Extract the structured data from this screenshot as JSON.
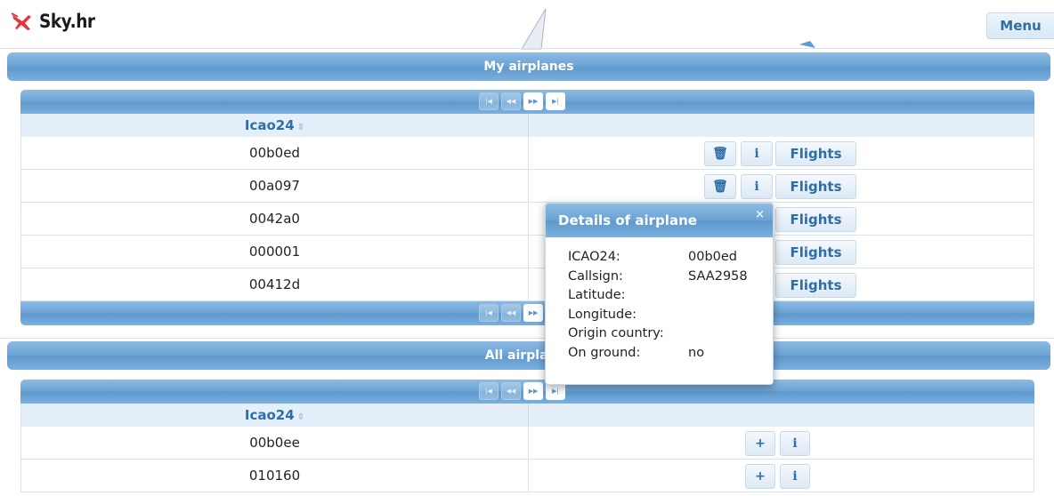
{
  "header": {
    "logo_text": "Sky.hr",
    "menu_label": "Menu"
  },
  "my_airplanes": {
    "title": "My airplanes",
    "column_header": "Icao24",
    "sort_glyph": "⇳",
    "rows": [
      {
        "icao24": "00b0ed",
        "flights_label": "Flights"
      },
      {
        "icao24": "00a097",
        "flights_label": "Flights"
      },
      {
        "icao24": "0042a0",
        "flights_label": "Flights"
      },
      {
        "icao24": "000001",
        "flights_label": "Flights"
      },
      {
        "icao24": "00412d",
        "flights_label": "Flights"
      }
    ]
  },
  "all_airplanes": {
    "title": "All airplanes",
    "column_header": "Icao24",
    "sort_glyph": "⇳",
    "rows": [
      {
        "icao24": "00b0ee"
      },
      {
        "icao24": "010160"
      }
    ]
  },
  "icons": {
    "delete": "trash-icon",
    "info": "info-icon",
    "add": "plus-icon",
    "close": "close-icon",
    "logo": "airplane-logo-icon"
  },
  "pager_glyphs": {
    "first": "|◀",
    "prev": "◀◀",
    "next": "▶▶",
    "last": "▶|"
  },
  "dialog": {
    "title": "Details of airplane",
    "close_glyph": "×",
    "fields": [
      {
        "label": "ICAO24:",
        "value": "00b0ed"
      },
      {
        "label": "Callsign:",
        "value": "SAA2958"
      },
      {
        "label": "Latitude:",
        "value": ""
      },
      {
        "label": "Longitude:",
        "value": ""
      },
      {
        "label": "Origin country:",
        "value": ""
      },
      {
        "label": "On ground:",
        "value": "no"
      }
    ]
  },
  "colors": {
    "accent": "#6aa2d4",
    "link": "#2e6ea6",
    "logo_red": "#e8323c"
  }
}
